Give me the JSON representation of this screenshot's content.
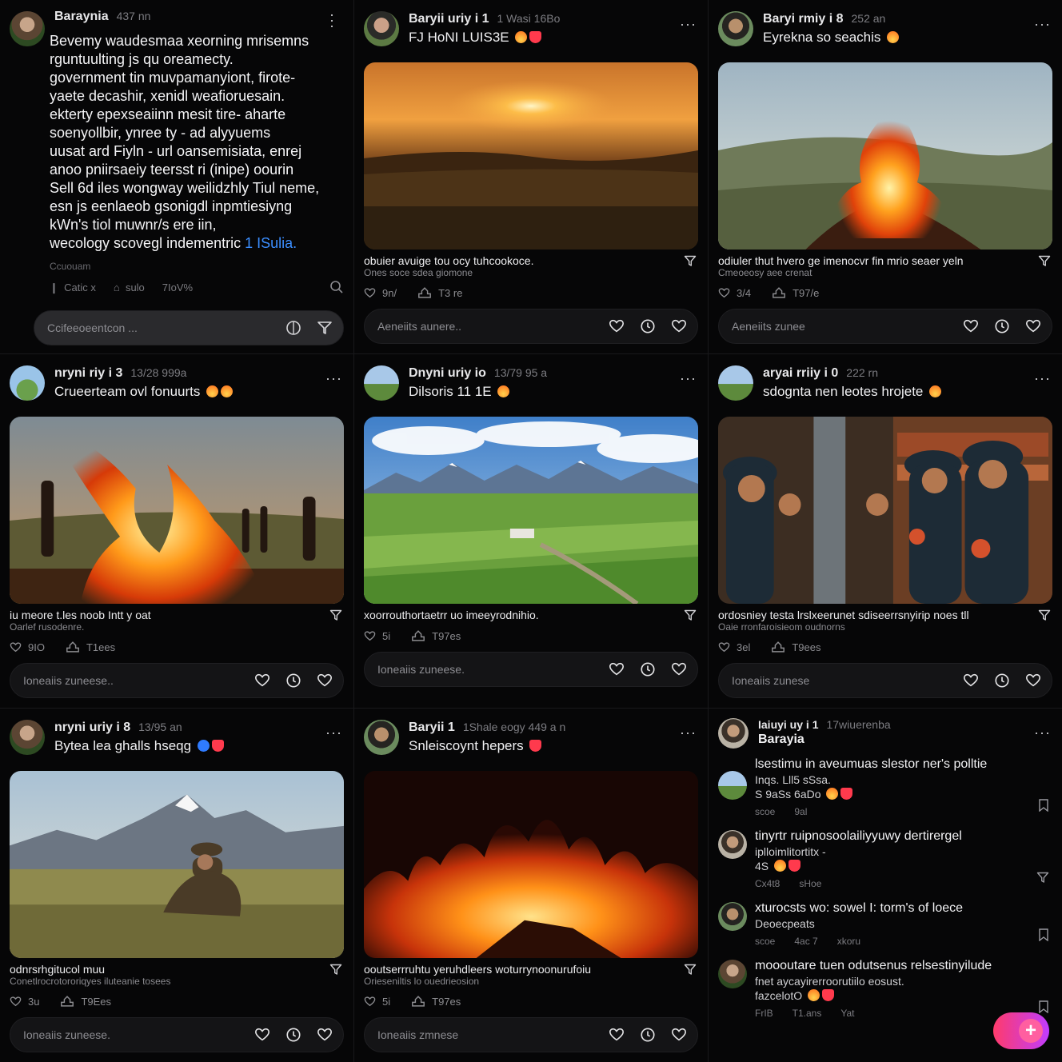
{
  "colors": {
    "background": "#050506",
    "accent_link": "#3b8eff",
    "heart": "#ff3a4d",
    "fab_gradient_start": "#ff3b6b",
    "fab_gradient_end": "#c13cff"
  },
  "posts": [
    {
      "name": "Baraynia",
      "time": "437 nn",
      "text_lines": [
        "Bevemy waudesmaa xeorning mrisemns",
        "rguntuulting js qu oreamecty.",
        "government tin muvpamanyiont, firote-",
        "yaete decashir, xenidl weafioruesain.",
        "ekterty epexseaiinn mesit tire- aharte",
        "soenyollbir, ynree ty - ad alyyuems",
        "uusat ard Fiyln - url oansemisiata, enrej",
        "anoo pniirsaeiy teersst ri (inipe) oourin",
        "Sell 6d iles wongway weilidzhly Tiul neme,",
        "esn js eenlaeob gsonigdl inpmtiesiyng",
        "kWn's tiol muwnr/s ere iin,"
      ],
      "last_line": "wecology scovegl indementric",
      "link_text": "1 ISulia.",
      "footer": "Ccuouam",
      "stats": [
        "Catic x",
        "sulo",
        "7IoV%"
      ],
      "comment_placeholder": "Ccifeeoeentcon ..."
    },
    {
      "name": "Baryii uriy i 1",
      "time": "1 Wasi 16Bo",
      "subtitle": "FJ HoNI LUIS3E",
      "caption": "obuier avuige tou ocy tuhcookoce.",
      "caption2": "Ones soce sdea giomone",
      "likes": "9n/",
      "shares": "T3 re",
      "comment_placeholder": "Aeneiits aunere.."
    },
    {
      "name": "Baryi rmiy i 8",
      "time": "252 an",
      "subtitle": "Eyrekna so seachis",
      "caption": "odiuler thut hvero ge imenocvr fin mrio seaer yeln",
      "caption2": "Cmeoeosy aee crenat",
      "likes": "3/4",
      "shares": "T97/e",
      "comment_placeholder": "Aeneiits zunee"
    },
    {
      "name": "nryni riy i 3",
      "time": "13/28 999a",
      "subtitle": "Crueerteam ovl fonuurts",
      "caption": "iu meore t.les noob Intt y oat",
      "caption2": "Oarlef rusodenre.",
      "likes": "9IO",
      "shares": "T1ees",
      "comment_placeholder": "Ioneaiis zuneese.."
    },
    {
      "name": "Dnyni uriy io",
      "time": "13/79 95 a",
      "subtitle": "Dilsoris 11 1E",
      "caption": "xoorrouthortaetrr uo imeeyrodnihio.",
      "caption2": "",
      "likes": "5i",
      "shares": "T97es",
      "comment_placeholder": "Ioneaiis zuneese."
    },
    {
      "name": "aryai rriiy i 0",
      "time": "222 rn",
      "subtitle": "sdognta nen leotes hrojete",
      "caption": "ordosniey testa lrslxeerunet sdiseerrsnyirip noes tll",
      "caption2": "Oaie rronfaroisieom oudnorns",
      "likes": "3el",
      "shares": "T9ees",
      "comment_placeholder": "Ioneaiis zunese"
    },
    {
      "name": "nryni uriy i 8",
      "time": "13/95 an",
      "subtitle": "Bytea lea ghalls hseqg",
      "caption": "odnrsrhgitucol muu",
      "caption2": "Conetlrocrotororiqyes iluteanie tosees",
      "likes": "3u",
      "shares": "T9Ees",
      "comment_placeholder": "Ioneaiis zuneese."
    },
    {
      "name": "Baryii 1",
      "time": "1Shale eogy 449 a n",
      "subtitle": "Snleiscoynt hepers",
      "caption": "ooutserrruhtu yeruhdleers woturrynoonurufoiu",
      "caption2": "Orieseniltis lo ouedrieosion",
      "likes": "5i",
      "shares": "T97es",
      "comment_placeholder": "Ioneaiis zmnese"
    }
  ],
  "thread": {
    "name": "Iaiuyi uy i 1",
    "time": "17wiuerenba",
    "title": "Barayia",
    "items": [
      {
        "line1": "lsestimu in aveumuas slestor ner's polltie",
        "line2": "Inqs. Lll5 sSsa.",
        "line3": "S 9aSs 6aDo",
        "meta": [
          "scoe",
          "9al"
        ]
      },
      {
        "line1": "tinyrtr ruipnosoolailiyyuwy dertirergel",
        "line2": "iplloimlitortitx -",
        "line3": "4S",
        "meta": [
          "Cx4t8",
          "sHoe"
        ]
      },
      {
        "line1": "xturocsts wo: sowel I: torm's of loece",
        "line2": "Deoecpeats",
        "line3": "",
        "meta": [
          "scoe",
          "4ac 7",
          "xkoru"
        ]
      },
      {
        "line1": "moooutare tuen odutsenus relsestinyilude",
        "line2": "fnet aycayirerroorutiilo eosust.",
        "line3": "fazcelotO",
        "meta": [
          "FrIB",
          "T1.ans",
          "Yat"
        ]
      }
    ]
  }
}
